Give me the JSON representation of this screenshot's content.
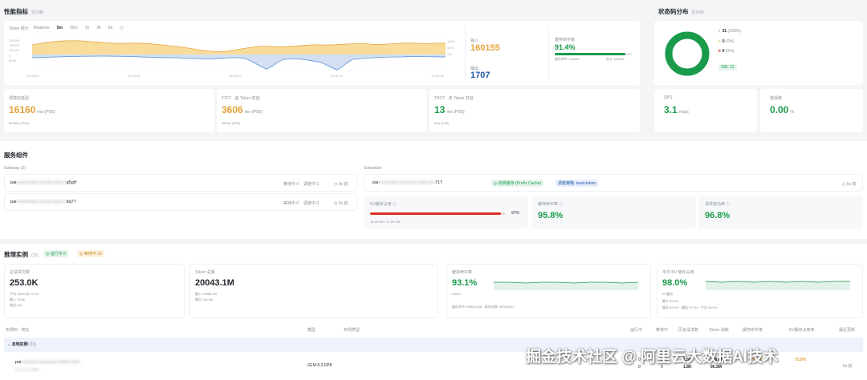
{
  "perf": {
    "title": "性能指标",
    "sub": "近10秒",
    "token_label": "Token 统计",
    "range_opts": [
      "Realtime",
      "5m",
      "30m",
      "1h",
      "3h",
      "6h"
    ],
    "y_ticks_left": [
      "200000",
      "160000",
      "100000",
      "0",
      "5000"
    ],
    "y_ticks_right": [
      "100%",
      "50%",
      "0%"
    ],
    "x_ticks": [
      "16:05:00",
      "16:15:00",
      "16:25:00",
      "16:35:00",
      "16:45:00"
    ],
    "input_label": "输入",
    "input_value": "160155",
    "output_label": "输出",
    "output_value": "1707",
    "cache_label": "缓存命中率",
    "cache_value": "91.4%",
    "cache_fill": 0.914,
    "cache_left": "缓存命中 146303",
    "cache_right": "总计 160155",
    "prefill_label": "预填充延迟",
    "prefill_value": "16160",
    "prefill_unit": "ms (P95)",
    "prefill_sub": "8034ms (P50)",
    "ttft_label": "TTFT · 首 Token 时延",
    "ttft_value": "3606",
    "ttft_unit": "ms (P95)",
    "ttft_sub": "989ms (P50)",
    "tpot_label": "TPOT · 单 Token 时延",
    "tpot_value": "13",
    "tpot_unit": "ms (P95)",
    "tpot_sub": "9ms (P50)",
    "qps_label": "QPS",
    "qps_value": "3.1",
    "qps_unit": "req/s",
    "err_label": "错误率",
    "err_value": "0.00",
    "err_unit": "%"
  },
  "status": {
    "title": "状态码分布",
    "sub": "近10秒",
    "rows": [
      {
        "icon": "✓",
        "count": "31",
        "pct": "(100%)",
        "color": "#1a9b4b"
      },
      {
        "icon": "⚠",
        "count": "0",
        "pct": "(0%)",
        "color": "#e6a23c"
      },
      {
        "icon": "⊗",
        "count": "0",
        "pct": "(0%)",
        "color": "#d93026"
      }
    ],
    "chip": "200: 31",
    "donut_fill": 1.0,
    "donut_color": "#1a9b4b"
  },
  "services": {
    "title": "服务组件",
    "gateway_label": "Gateway",
    "gateway_count": "(2)",
    "gateways": [
      {
        "name": "pai-",
        "hidden": "xxxxxxxxx-xxxxxx-xxxx-x",
        "suffix": "g5grf",
        "wait": "等待中 0",
        "sched": "调度中 0",
        "time": "5s 前"
      },
      {
        "name": "pai-",
        "hidden": "xxxxxxxxx-xxxxxx-xxxx-x",
        "suffix": "bq77",
        "wait": "等待中 0",
        "sched": "调度中 0",
        "time": "5s 前"
      }
    ],
    "scheduler_label": "Scheduler",
    "scheduler_name": "pai-",
    "scheduler_hidden": "xxxxxxxx-xxxxxxxx-xxxx-xxx",
    "scheduler_suffix": "717",
    "prefix_tag": "◎ 前缀缓存 (Prefix Cache)",
    "policy_tag": "调度策略: least-token",
    "scheduler_time": "5s 前",
    "kv_label": "KV缓存占用",
    "kv_value": "97%",
    "kv_fill": 0.97,
    "kv_sub": "16.50 GB / 17.00 GB",
    "hit_label": "缓存命中率",
    "hit_value": "95.8%",
    "hit2_label": "请求成功率",
    "hit2_value": "96.8%"
  },
  "instances": {
    "title": "推理实例",
    "count": "(23)",
    "running_tag": "◎ 运行中 0",
    "waiting_tag": "◎ 等待中 23",
    "total_req_label": "总请求次数",
    "total_req_value": "253.0K",
    "total_req_sub1": "平均 Token/次 79.1K",
    "total_req_sub2": "输入 78.6K",
    "total_req_sub3": "输出 241",
    "tokens_label": "Token 总量",
    "tokens_value": "20043.1M",
    "tokens_sub1": "输入 19888.2M",
    "tokens_sub2": "输出 154.9M",
    "cache_rate_label": "缓存命中率",
    "cache_rate_value": "93.1%",
    "cache_rate_sub1": "LMCP",
    "cache_rate_sub2": "缓存命中 185631256 · 请求总数 199352611",
    "kv_label": "平均 KV 缓存占用",
    "kv_value": "98.0%",
    "kv_sub1": "KV缓存",
    "kv_sub2": "最大 99.9%",
    "kv_sub3": "缓存 99.9% · 最低 97.4% · 平均 98.0%",
    "table_headers": [
      "实例ID · 地址",
      "模型",
      "实例类型",
      "运行中",
      "等待中",
      "历史请求数",
      "Token 消耗",
      "缓存命中率",
      "KV缓存占用率",
      "最近更新"
    ],
    "group_label": "本地实例",
    "group_count": "(23)",
    "row_name": "pai-",
    "row_hidden": "xxxxxxx-xxxxxxxx-xxxxx-xxxx",
    "row_addr": "10.xx.xx.xx:8000",
    "row_model": "GLM-5.2-FP8",
    "row_cols": [
      "0",
      "0",
      "2.8K",
      "208.6M",
      "74.6%",
      "75.8%",
      "5s 前"
    ],
    "row2_cols": [
      "0",
      "0",
      "1.8K",
      "95.2M",
      "",
      "",
      ""
    ]
  },
  "watermark": "掘金技术社区 @ 阿里云大数据AI技术"
}
